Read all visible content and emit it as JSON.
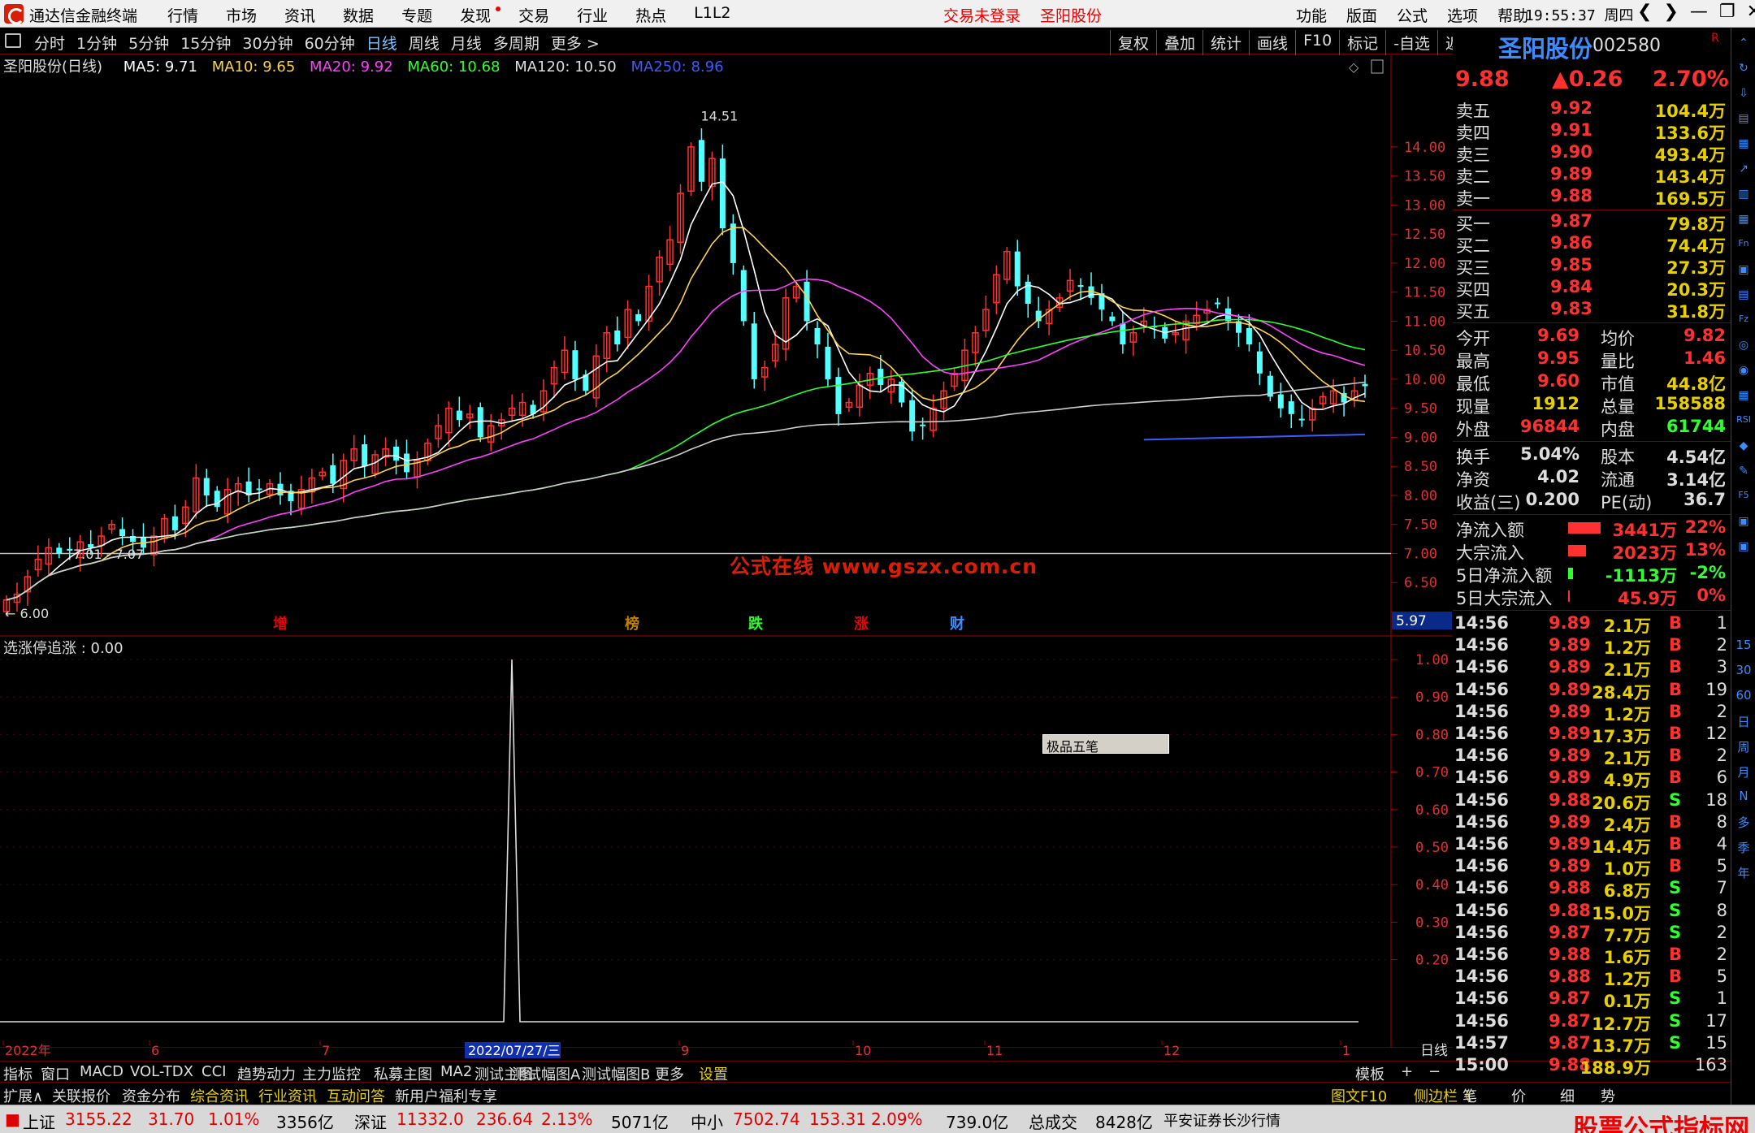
{
  "menubar": {
    "title": "通达信金融终端",
    "menus": [
      "行情",
      "市场",
      "资讯",
      "数据",
      "专题",
      "发现",
      "交易",
      "行业",
      "热点",
      "L1L2"
    ],
    "login": "交易未登录",
    "stock": "圣阳股份",
    "right": [
      "功能",
      "版面",
      "公式",
      "选项",
      "帮助"
    ],
    "clock": "19:55:37 周四"
  },
  "periodbar": {
    "tabs": [
      "分时",
      "1分钟",
      "5分钟",
      "15分钟",
      "30分钟",
      "60分钟",
      "日线",
      "周线",
      "月线",
      "多周期",
      "更多 >"
    ],
    "active": "日线",
    "tools": [
      "复权",
      "叠加",
      "统计",
      "画线",
      "F10",
      "标记",
      "-自选",
      "返回"
    ]
  },
  "stock": {
    "name": "圣阳股份",
    "code": "002580",
    "flag": "R",
    "price": "9.88",
    "change": "▲0.26",
    "pct": "2.70%"
  },
  "legend": {
    "name": "圣阳股份(日线)",
    "ma5": "MA5: 9.71",
    "ma10": "MA10: 9.65",
    "ma20": "MA20: 9.92",
    "ma60": "MA60: 10.68",
    "ma120": "MA120: 10.50",
    "ma250": "MA250: 8.96"
  },
  "chart_data": {
    "type": "candlestick",
    "y_ticks": [
      "14.00",
      "13.50",
      "13.00",
      "12.50",
      "12.00",
      "11.50",
      "11.00",
      "10.50",
      "10.00",
      "9.50",
      "9.00",
      "8.50",
      "8.00",
      "7.50",
      "7.00",
      "6.50"
    ],
    "ylim": [
      6.0,
      14.6
    ],
    "high_label": "14.51",
    "low_label": "6.00",
    "range_label": "7.01 - 7.07",
    "cursor_price": "5.97",
    "markers": [
      "增",
      "榜",
      "跌",
      "涨",
      "财"
    ],
    "x_labels": [
      "2022年",
      "6",
      "7",
      "2022/07/27/三",
      "9",
      "10",
      "11",
      "12",
      "1"
    ],
    "close_series": [
      6.2,
      6.3,
      6.6,
      6.9,
      7.1,
      7.0,
      7.05,
      7.2,
      7.1,
      7.3,
      7.5,
      7.3,
      7.2,
      7.1,
      7.3,
      7.6,
      7.4,
      7.8,
      8.3,
      8.0,
      7.8,
      8.1,
      8.2,
      8.0,
      8.1,
      8.2,
      8.0,
      7.9,
      8.1,
      8.3,
      8.4,
      8.2,
      8.6,
      8.8,
      8.5,
      8.7,
      8.8,
      8.6,
      8.4,
      8.6,
      8.9,
      9.2,
      9.5,
      9.3,
      9.4,
      9.0,
      9.2,
      9.3,
      9.5,
      9.6,
      9.4,
      9.8,
      10.2,
      10.5,
      10.0,
      9.8,
      10.4,
      10.8,
      10.6,
      11.2,
      11.0,
      11.6,
      12.1,
      12.4,
      13.2,
      14.0,
      13.4,
      13.8,
      12.6,
      12.0,
      11.0,
      10.0,
      10.2,
      10.6,
      11.4,
      11.6,
      11.0,
      10.6,
      10.0,
      9.4,
      9.6,
      9.9,
      10.1,
      9.9,
      10.0,
      9.6,
      9.1,
      9.2,
      9.5,
      9.8,
      10.1,
      10.5,
      10.8,
      11.2,
      11.8,
      12.2,
      11.6,
      11.3,
      11.0,
      11.2,
      11.4,
      11.7,
      11.6,
      11.4,
      11.2,
      11.0,
      10.6,
      10.8,
      11.0,
      10.9,
      10.7,
      10.8,
      11.0,
      11.1,
      11.2,
      11.3,
      11.0,
      10.8,
      10.6,
      10.1,
      9.7,
      9.5,
      9.4,
      9.3,
      9.5,
      9.7,
      9.8,
      9.6,
      9.8,
      9.88
    ]
  },
  "indicator": {
    "legend": "选涨停追涨 : 0.00",
    "ticks": [
      "1.00",
      "0.90",
      "0.80",
      "0.70",
      "0.60",
      "0.50",
      "0.40",
      "0.30",
      "0.20"
    ],
    "popup": "极品五笔"
  },
  "xaxis_right": "日线",
  "bottomtabs": [
    "指标",
    "窗口",
    "MACD",
    "VOL-TDX",
    "CCI",
    "趋势动力",
    "主力监控",
    "私募主图",
    "MA2",
    "测试主图",
    "测试幅图A",
    "测试幅图B",
    "更多",
    "设置"
  ],
  "bottomright": [
    "模板",
    "+",
    "−"
  ],
  "bottomtabs2": [
    "扩展∧",
    "关联报价",
    "资金分布",
    "综合资讯",
    "行业资讯",
    "互动问答",
    "新用户福利专享"
  ],
  "bottomright2": [
    "图文F10",
    "侧边栏《",
    "笔",
    "价",
    "细",
    "势"
  ],
  "status": {
    "sh": "上证",
    "sh_v": "3155.22",
    "sh_c": "31.70",
    "sh_p": "1.01%",
    "sh_a": "3356亿",
    "sz": "深证",
    "sz_v": "11332.0",
    "sz_c": "236.64",
    "sz_p": "2.13%",
    "sz_a": "5071亿",
    "zx": "中小",
    "zx_v": "7502.74",
    "zx_c": "153.31",
    "zx_p": "2.09%",
    "zx_a": "739.0亿",
    "total": "总成交",
    "total_v": "8428亿",
    "broker": "平安证券长沙行情"
  },
  "watermark": "公式在线 www.gszx.com.cn",
  "badge": {
    "big": "股票公式指标网",
    "small": "www.gszx.com.cn"
  },
  "orderbook": {
    "sell": [
      [
        "卖五",
        "9.92",
        "104.4万"
      ],
      [
        "卖四",
        "9.91",
        "133.6万"
      ],
      [
        "卖三",
        "9.90",
        "493.4万"
      ],
      [
        "卖二",
        "9.89",
        "143.4万"
      ],
      [
        "卖一",
        "9.88",
        "169.5万"
      ]
    ],
    "buy": [
      [
        "买一",
        "9.87",
        "79.8万"
      ],
      [
        "买二",
        "9.86",
        "74.4万"
      ],
      [
        "买三",
        "9.85",
        "27.3万"
      ],
      [
        "买四",
        "9.84",
        "20.3万"
      ],
      [
        "买五",
        "9.83",
        "31.8万"
      ]
    ]
  },
  "quote": [
    [
      "今开",
      "9.69",
      "均价",
      "9.82"
    ],
    [
      "最高",
      "9.95",
      "量比",
      "1.46"
    ],
    [
      "最低",
      "9.60",
      "市值",
      "44.8亿"
    ],
    [
      "现量",
      "1912",
      "总量",
      "158588"
    ],
    [
      "外盘",
      "96844",
      "内盘",
      "61744"
    ]
  ],
  "quote2": [
    [
      "换手",
      "5.04%",
      "股本",
      "4.54亿"
    ],
    [
      "净资",
      "4.02",
      "流通",
      "3.14亿"
    ],
    [
      "收益(三)",
      "0.200",
      "PE(动)",
      "36.7"
    ]
  ],
  "flow": [
    [
      "净流入额",
      "3441万",
      "22%"
    ],
    [
      "大宗流入",
      "2023万",
      "13%"
    ],
    [
      "5日净流入额",
      "-1113万",
      "-2%"
    ],
    [
      "5日大宗流入",
      "45.9万",
      "0%"
    ]
  ],
  "ticks": [
    [
      "14:56",
      "9.89",
      "2.1万",
      "B",
      "1"
    ],
    [
      "14:56",
      "9.89",
      "1.2万",
      "B",
      "2"
    ],
    [
      "14:56",
      "9.89",
      "2.1万",
      "B",
      "3"
    ],
    [
      "14:56",
      "9.89",
      "28.4万",
      "B",
      "19"
    ],
    [
      "14:56",
      "9.89",
      "1.2万",
      "B",
      "2"
    ],
    [
      "14:56",
      "9.89",
      "17.3万",
      "B",
      "12"
    ],
    [
      "14:56",
      "9.89",
      "2.1万",
      "B",
      "2"
    ],
    [
      "14:56",
      "9.89",
      "4.9万",
      "B",
      "6"
    ],
    [
      "14:56",
      "9.88",
      "20.6万",
      "S",
      "18"
    ],
    [
      "14:56",
      "9.89",
      "2.4万",
      "B",
      "8"
    ],
    [
      "14:56",
      "9.89",
      "14.4万",
      "B",
      "4"
    ],
    [
      "14:56",
      "9.89",
      "1.0万",
      "B",
      "5"
    ],
    [
      "14:56",
      "9.88",
      "6.8万",
      "S",
      "7"
    ],
    [
      "14:56",
      "9.88",
      "15.0万",
      "S",
      "8"
    ],
    [
      "14:56",
      "9.87",
      "7.7万",
      "S",
      "2"
    ],
    [
      "14:56",
      "9.88",
      "1.6万",
      "B",
      "2"
    ],
    [
      "14:56",
      "9.88",
      "1.2万",
      "B",
      "5"
    ],
    [
      "14:56",
      "9.87",
      "0.1万",
      "S",
      "1"
    ],
    [
      "14:56",
      "9.87",
      "12.7万",
      "S",
      "17"
    ],
    [
      "14:57",
      "9.87",
      "13.7万",
      "S",
      "15"
    ],
    [
      "15:00",
      "9.88",
      "188.9万",
      "",
      "163"
    ]
  ],
  "sidetools": [
    "15",
    "30",
    "60",
    "日",
    "周",
    "月",
    "N",
    "多",
    "季",
    "年"
  ]
}
